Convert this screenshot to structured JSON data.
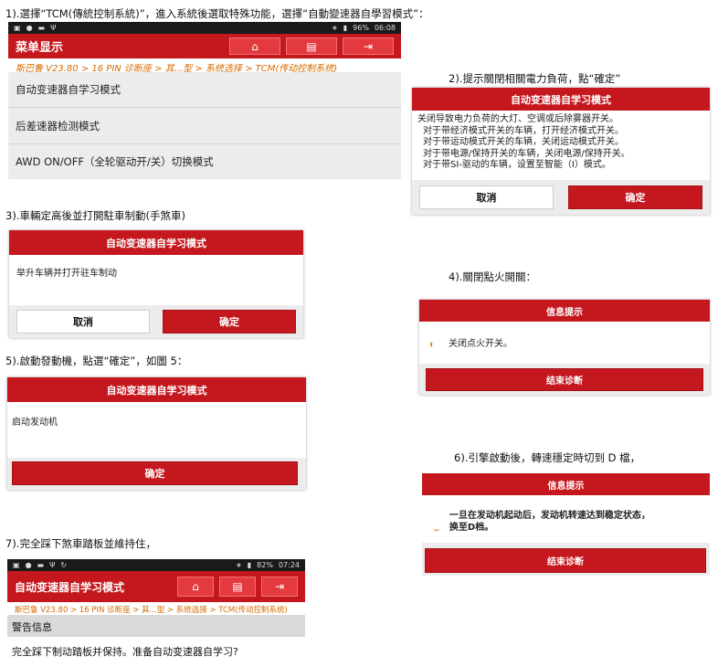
{
  "steps": {
    "s1": "1).選擇“TCM(傳統控制系統)”，進入系統後選取特殊功能，選擇“自動變速器自學習模式”：",
    "s2": "2).提示關閉相關電力負荷，點“確定”",
    "s3": "3).車輛定高後並打開駐車制動(手煞車)",
    "s4": "4).關閉點火開關：",
    "s5": "5).啟動發動機，點選“確定”，如圖 5：",
    "s6": "6).引擎啟動後，轉速穩定時切到 D 檔，",
    "s7": "7).完全踩下煞車踏板並維持住，"
  },
  "screen1": {
    "status_time": "06:08",
    "status_battery": "96%",
    "title": "菜单显示",
    "breadcrumb": "斯巴鲁 V23.80 > 16 PIN 诊断座 > 其...型 > 系统选择 > TCM(传动控制系统)",
    "items": [
      {
        "label": "自动变速器自学习模式"
      },
      {
        "label": "后差速器检测模式"
      },
      {
        "label": "AWD ON/OFF（全轮驱动开/关）切换模式"
      }
    ]
  },
  "dialog2": {
    "title": "自动变速器自学习模式",
    "lines": [
      "关闭导致电力负荷的大灯、空调或后除雾器开关。",
      "对于带经济模式开关的车辆，打开经济模式开关。",
      "对于带运动模式开关的车辆，关闭运动模式开关。",
      "对于带电源/保持开关的车辆，关闭电源/保持开关。",
      "对于带SI-驱动的车辆，设置至智能（I）模式。"
    ],
    "cancel": "取消",
    "ok": "确定"
  },
  "dialog3": {
    "title": "自动变速器自学习模式",
    "message": "举升车辆并打开驻车制动",
    "cancel": "取消",
    "ok": "确定"
  },
  "dialog4": {
    "title": "信息提示",
    "message": "关闭点火开关。",
    "button": "结束诊断"
  },
  "dialog5": {
    "title": "自动变速器自学习模式",
    "message": "启动发动机",
    "ok": "确定"
  },
  "dialog6": {
    "title": "信息提示",
    "message_line1": "一旦在发动机起动后，发动机转速达到稳定状态，",
    "message_line2": "换至D档。",
    "button": "结束诊断"
  },
  "screen7": {
    "status_time": "07:24",
    "status_battery": "82%",
    "title": "自动变速器自学习模式",
    "breadcrumb": "斯巴鲁 V23.80 > 16 PIN 诊断座 > 其...型 > 系统选择 > TCM(传动控制系统)",
    "warning_header": "警告信息",
    "warning_text": "完全踩下制动踏板并保持。准备自动变速器自学习?"
  },
  "colors": {
    "accent": "#c4181e",
    "breadcrumb": "#d66a00"
  },
  "icons": [
    "home-icon",
    "printer-icon",
    "exit-icon"
  ]
}
